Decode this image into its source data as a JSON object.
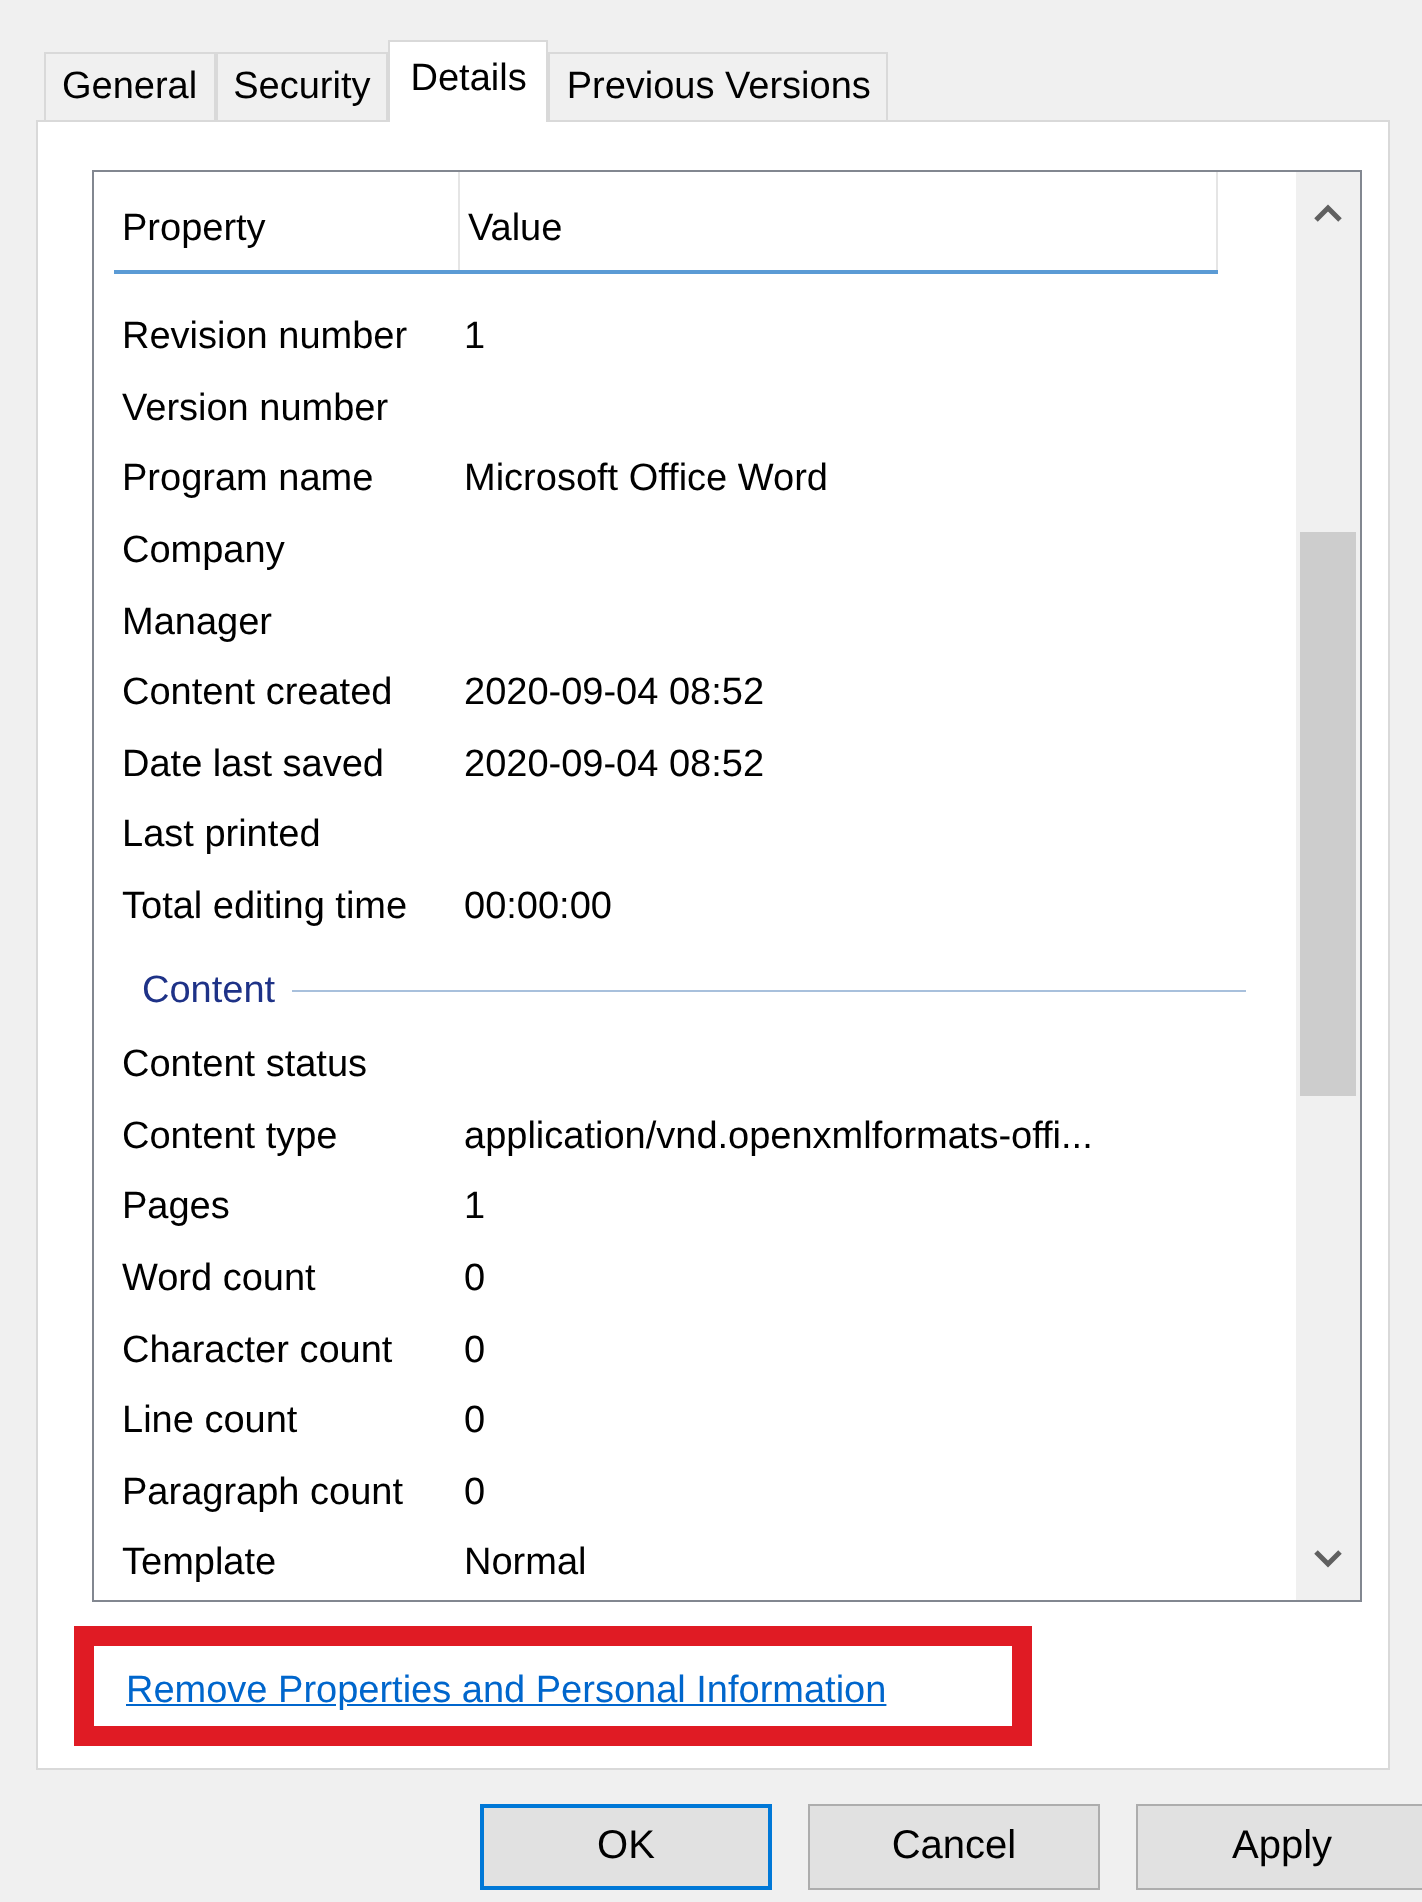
{
  "tabs": [
    {
      "label": "General",
      "selected": false
    },
    {
      "label": "Security",
      "selected": false
    },
    {
      "label": "Details",
      "selected": true
    },
    {
      "label": "Previous Versions",
      "selected": false
    }
  ],
  "columns": [
    "Property",
    "Value"
  ],
  "rows": [
    {
      "kind": "row",
      "property": "Revision number",
      "value": "1"
    },
    {
      "kind": "row",
      "property": "Version number"
    },
    {
      "kind": "row",
      "property": "Program name",
      "value": "Microsoft Office Word"
    },
    {
      "kind": "row",
      "property": "Company"
    },
    {
      "kind": "row",
      "property": "Manager"
    },
    {
      "kind": "row",
      "property": "Content created",
      "value": "2020-09-04 08:52"
    },
    {
      "kind": "row",
      "property": "Date last saved",
      "value": "2020-09-04 08:52"
    },
    {
      "kind": "row",
      "property": "Last printed"
    },
    {
      "kind": "row",
      "property": "Total editing time",
      "value": "00:00:00"
    },
    {
      "kind": "group",
      "property": "Content"
    },
    {
      "kind": "row",
      "property": "Content status"
    },
    {
      "kind": "row",
      "property": "Content type",
      "value": "application/vnd.openxmlformats-offi..."
    },
    {
      "kind": "row",
      "property": "Pages",
      "value": "1"
    },
    {
      "kind": "row",
      "property": "Word count",
      "value": "0"
    },
    {
      "kind": "row",
      "property": "Character count",
      "value": "0"
    },
    {
      "kind": "row",
      "property": "Line count",
      "value": "0"
    },
    {
      "kind": "row",
      "property": "Paragraph count",
      "value": "0"
    },
    {
      "kind": "row",
      "property": "Template",
      "value": "Normal"
    }
  ],
  "link": {
    "label": "Remove Properties and Personal Information",
    "highlighted": true
  },
  "buttons": [
    {
      "label": "OK",
      "default": true
    },
    {
      "label": "Cancel",
      "default": false
    },
    {
      "label": "Apply",
      "default": false
    }
  ]
}
